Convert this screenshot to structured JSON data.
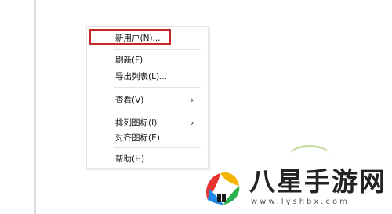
{
  "context_menu": {
    "items": [
      {
        "label": "新用户(N)...",
        "highlighted": true
      },
      {
        "label": "刷新(F)"
      },
      {
        "label": "导出列表(L)..."
      },
      {
        "label": "查看(V)",
        "submenu_arrow": "›"
      },
      {
        "label": "排列图标(I)",
        "submenu_arrow": "›"
      },
      {
        "label": "对齐图标(E)"
      },
      {
        "label": "帮助(H)"
      }
    ],
    "highlight_color": "#c62828"
  },
  "watermark": {
    "title": "八星手游网",
    "url": "www.lyshbx.com",
    "logo_icon": "colored-leaf-logo"
  }
}
